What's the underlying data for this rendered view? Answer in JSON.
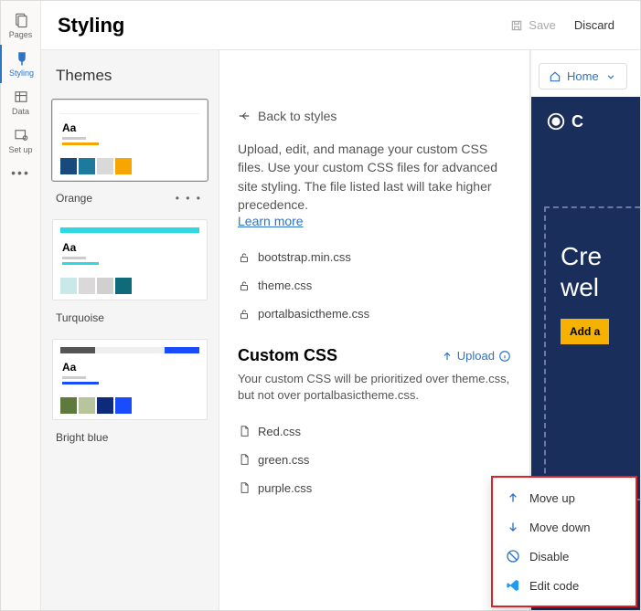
{
  "nav": {
    "items": [
      {
        "label": "Pages",
        "icon": "pages"
      },
      {
        "label": "Styling",
        "icon": "brush",
        "active": true
      },
      {
        "label": "Data",
        "icon": "table"
      },
      {
        "label": "Set up",
        "icon": "gear"
      },
      {
        "label": "",
        "icon": "more"
      }
    ]
  },
  "header": {
    "title": "Styling",
    "save": "Save",
    "discard": "Discard"
  },
  "themes": {
    "heading": "Themes",
    "items": [
      {
        "name": "Orange",
        "bar": "#ffffff",
        "line": "#f7a500",
        "swatches": [
          "#184a7c",
          "#1e7a9c",
          "#d9d9d9",
          "#f7a500"
        ],
        "selected": true
      },
      {
        "name": "Turquoise",
        "bar": "#2dd8e0",
        "line": "#2dd8e0",
        "swatches": [
          "#c9e8e8",
          "#d9d9d9",
          "#d1cfcf",
          "#0f6a7a"
        ]
      },
      {
        "name": "Bright blue",
        "bar_seg": [
          "#555",
          "#eee",
          "#eee",
          "#1a4cff"
        ],
        "line": "#1a4cff",
        "swatches": [
          "#5e7a3c",
          "#b7c49c",
          "#0e2a7a",
          "#1a4cff"
        ]
      }
    ]
  },
  "center": {
    "back": "Back to styles",
    "desc": "Upload, edit, and manage your custom CSS files. Use your custom CSS files for advanced site styling. The file listed last will take higher precedence.",
    "learn": "Learn more",
    "system_files": [
      "bootstrap.min.css",
      "theme.css",
      "portalbasictheme.css"
    ],
    "custom_heading": "Custom CSS",
    "upload": "Upload",
    "custom_desc": "Your custom CSS will be prioritized over theme.css, but not over portalbasictheme.css.",
    "custom_files": [
      "Red.css",
      "green.css",
      "purple.css"
    ]
  },
  "preview": {
    "home": "Home",
    "brand": "C",
    "hero_line1": "Cre",
    "hero_line2": "wel",
    "cta": "Add a"
  },
  "context_menu": {
    "items": [
      {
        "label": "Move up",
        "icon": "arrow-up"
      },
      {
        "label": "Move down",
        "icon": "arrow-down"
      },
      {
        "label": "Disable",
        "icon": "disable"
      },
      {
        "label": "Edit code",
        "icon": "vscode"
      }
    ]
  }
}
